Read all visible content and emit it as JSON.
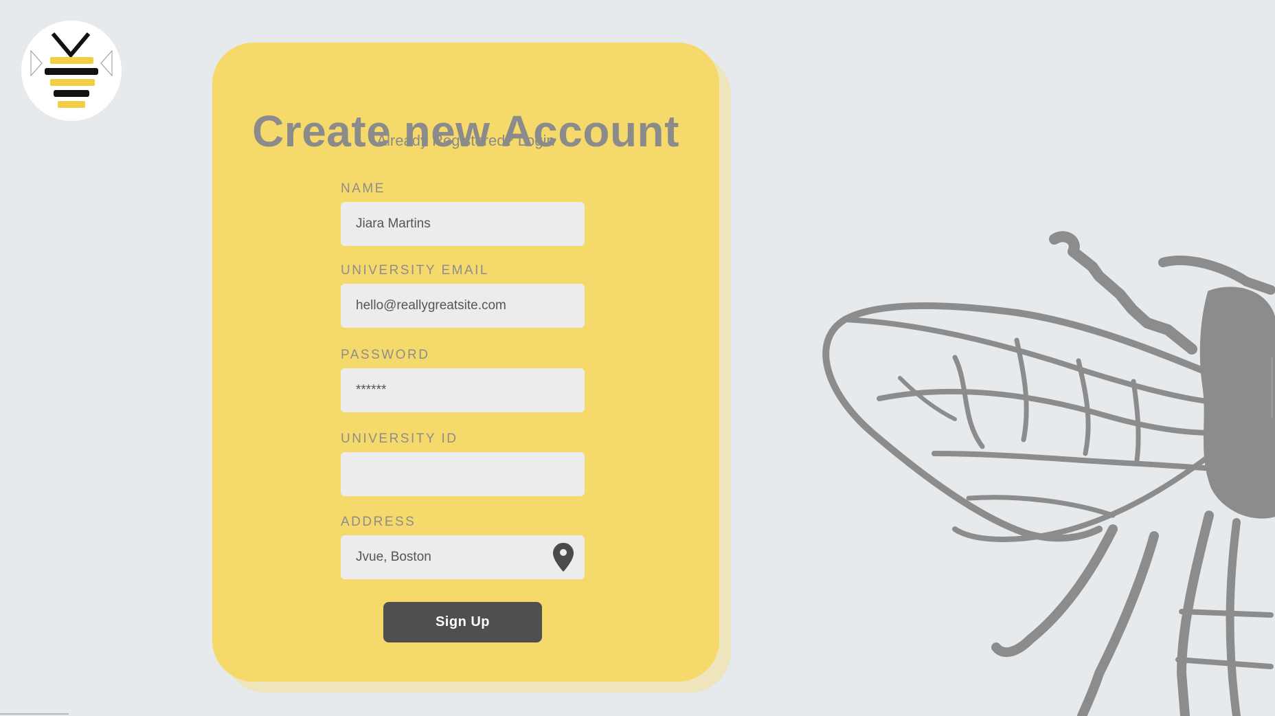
{
  "logo": {
    "icon": "bee-logo-icon"
  },
  "form": {
    "title": "Create new Account",
    "login_link": "Already Registered? Login",
    "fields": {
      "name": {
        "label": "NAME",
        "value": "Jiara Martins"
      },
      "email": {
        "label": "UNIVERSITY EMAIL",
        "value": "hello@reallygreatsite.com"
      },
      "password": {
        "label": "PASSWORD",
        "value": "******"
      },
      "university_id": {
        "label": "UNIVERSITY ID",
        "value": ""
      },
      "address": {
        "label": "ADDRESS",
        "value": "Jvue, Boston",
        "icon": "location-pin-icon"
      }
    },
    "submit_label": "Sign Up"
  },
  "decoration": {
    "icon": "bee-illustration-icon"
  },
  "colors": {
    "background": "#e7eaed",
    "card": "#f5d96b",
    "card_shadow": "#efe5bd",
    "input": "#ececec",
    "text_muted": "#8b8b8b",
    "button": "#4f4f4f",
    "illustration": "#8c8c8c"
  }
}
